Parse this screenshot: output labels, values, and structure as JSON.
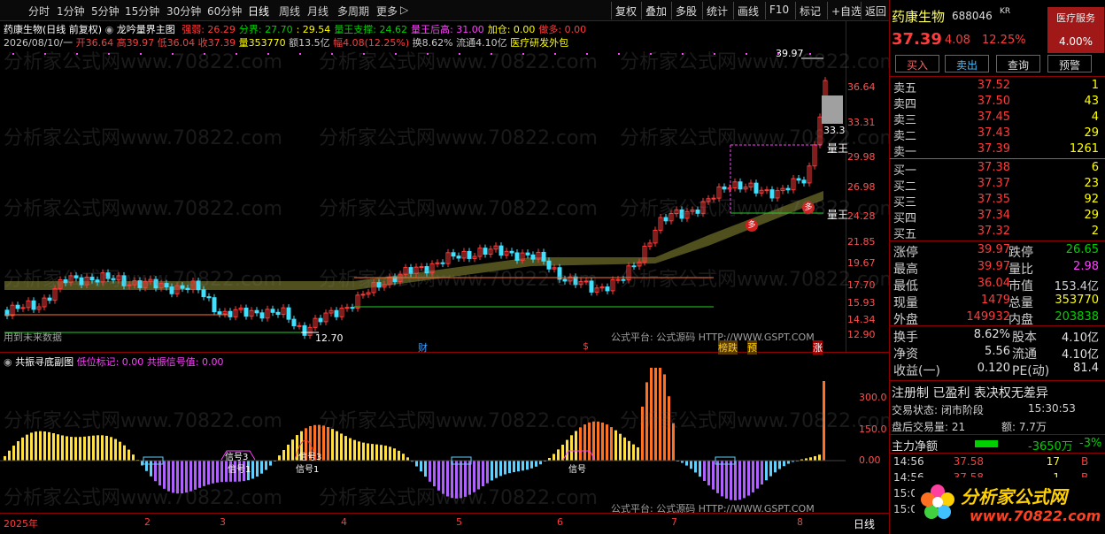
{
  "toolbar": {
    "periods": [
      "分时",
      "1分钟",
      "5分钟",
      "15分钟",
      "30分钟",
      "60分钟",
      "日线",
      "周线",
      "月线",
      "多周期",
      "更多"
    ],
    "more_arrow": "▷",
    "right_items": [
      "复权",
      "叠加",
      "多股",
      "统计",
      "画线",
      "F10",
      "标记",
      "+自选",
      "返回"
    ]
  },
  "main_chart": {
    "title": "药康生物(日线 前复权)",
    "indicator_name": "龙吟量界主图",
    "indicator_values": [
      {
        "label": "强弱: 26.29",
        "color": "#ff3b3b"
      },
      {
        "label": "分界: 27.70",
        "color": "#00d000"
      },
      {
        "label": ": 29.54",
        "color": "#ffff00"
      },
      {
        "label": "量王支撑: 24.62",
        "color": "#00d000"
      },
      {
        "label": "量王后高: 31.00",
        "color": "#ff40ff"
      },
      {
        "label": "加仓: 0.00",
        "color": "#ffff00"
      },
      {
        "label": "做多: 0.00",
        "color": "#ff3b3b"
      }
    ],
    "ohlc_line": [
      {
        "text": "2026/08/10/一 ",
        "color": "#c8c8c8"
      },
      {
        "text": "开36.64 ",
        "color": "#ff3b3b"
      },
      {
        "text": "高39.97 ",
        "color": "#ff3b3b"
      },
      {
        "text": "低36.04 ",
        "color": "#ff3b3b"
      },
      {
        "text": "收37.39 ",
        "color": "#ff3b3b"
      },
      {
        "text": "量353770 ",
        "color": "#ffff00"
      },
      {
        "text": "额13.5亿 ",
        "color": "#c8c8c8"
      },
      {
        "text": "幅4.08(12.25%) ",
        "color": "#ff3b3b"
      },
      {
        "text": "换8.62% ",
        "color": "#c8c8c8"
      },
      {
        "text": "流通4.10亿 ",
        "color": "#c8c8c8"
      },
      {
        "text": "医疗研发外包",
        "color": "#ffff00"
      }
    ],
    "price_axis": [
      "36.64",
      "33.31",
      "29.98",
      "26.98",
      "24.28",
      "21.85",
      "19.67",
      "17.70",
      "15.93",
      "14.34",
      "12.90"
    ],
    "high_marker": "39.97",
    "low_marker": "12.70",
    "cursor_price": "33.3",
    "label_liangwang": "量王",
    "note_future": "用到未来数据",
    "platform_note": "公式平台: 公式源码 HTTP://WWW.GSPT.COM",
    "event_badges": [
      {
        "text": "财",
        "color": "#3aa0ff"
      },
      {
        "text": "$",
        "color": "#ff3b3b"
      },
      {
        "text": "榜跌",
        "color": "#ffd000"
      },
      {
        "text": "预",
        "color": "#ffd000"
      },
      {
        "text": "涨",
        "color": "#ff3b3b"
      }
    ],
    "signal_badge": "多"
  },
  "sub_chart": {
    "name": "共振寻底副图",
    "values": [
      {
        "label": "低位标记: 0.00",
        "color": "#ff40ff"
      },
      {
        "label": "共振信号值: 0.00",
        "color": "#ff40ff"
      }
    ],
    "axis": [
      "300.0",
      "150.0",
      "0.00"
    ],
    "signal_labels": [
      "信号3",
      "信号1",
      "信号3",
      "信号1",
      "信号"
    ],
    "platform_note": "公式平台: 公式源码 HTTP://WWW.GSPT.COM"
  },
  "time_axis": {
    "labels": [
      "2025年",
      "2",
      "3",
      "4",
      "5",
      "6",
      "7",
      "8"
    ],
    "period": "日线"
  },
  "watermark": "分析家公式网www.70822.com",
  "stock": {
    "name": "药康生物",
    "code": "688046",
    "market": "KR",
    "sector": "医疗服务",
    "sector_change": "4.00%",
    "price": "37.39",
    "change": "4.08",
    "change_pct": "12.25%"
  },
  "trade_buttons": [
    "买入",
    "卖出",
    "查询",
    "预警"
  ],
  "order_book": {
    "asks": [
      {
        "label": "卖五",
        "price": "37.52",
        "vol": "1"
      },
      {
        "label": "卖四",
        "price": "37.50",
        "vol": "43"
      },
      {
        "label": "卖三",
        "price": "37.45",
        "vol": "4"
      },
      {
        "label": "卖二",
        "price": "37.43",
        "vol": "29"
      },
      {
        "label": "卖一",
        "price": "37.39",
        "vol": "1261"
      }
    ],
    "bids": [
      {
        "label": "买一",
        "price": "37.38",
        "vol": "6"
      },
      {
        "label": "买二",
        "price": "37.37",
        "vol": "23"
      },
      {
        "label": "买三",
        "price": "37.35",
        "vol": "92"
      },
      {
        "label": "买四",
        "price": "37.34",
        "vol": "29"
      },
      {
        "label": "买五",
        "price": "37.32",
        "vol": "2"
      }
    ]
  },
  "stats": [
    {
      "l1": "涨停",
      "v1": "39.97",
      "c1": "#ff3b3b",
      "l2": "跌停",
      "v2": "26.65",
      "c2": "#00d000"
    },
    {
      "l1": "最高",
      "v1": "39.97",
      "c1": "#ff3b3b",
      "l2": "量比",
      "v2": "2.98",
      "c2": "#ff40ff"
    },
    {
      "l1": "最低",
      "v1": "36.04",
      "c1": "#ff3b3b",
      "l2": "市值",
      "v2": "153.4亿",
      "c2": "#d0d0d0"
    },
    {
      "l1": "现量",
      "v1": "1479",
      "c1": "#ff3b3b",
      "l2": "总量",
      "v2": "353770",
      "c2": "#ffff00"
    },
    {
      "l1": "外盘",
      "v1": "149932",
      "c1": "#ff3b3b",
      "l2": "内盘",
      "v2": "203838",
      "c2": "#00d000"
    }
  ],
  "stats2": [
    {
      "l1": "换手",
      "v1": "8.62%",
      "l2": "股本",
      "v2": "4.10亿"
    },
    {
      "l1": "净资",
      "v1": "5.56",
      "l2": "流通",
      "v2": "4.10亿"
    },
    {
      "l1": "收益(一)",
      "v1": "0.120",
      "l2": "PE(动)",
      "v2": "81.4"
    }
  ],
  "registration": "注册制 已盈利 表决权无差异",
  "trade_state": {
    "label": "交易状态: 闭市阶段",
    "time": "15:30:53"
  },
  "after_hours": {
    "label": "盘后交易量: 21",
    "amount": "额: 7.7万"
  },
  "main_flow": {
    "label": "主力净额",
    "value": "-3650万",
    "pct": "-3%"
  },
  "ticks": [
    {
      "time": "14:56",
      "price": "37.58",
      "vol": "17",
      "side": "B"
    },
    {
      "time": "14:56",
      "price": "37.58",
      "vol": "1",
      "side": "B"
    },
    {
      "time": "15:00",
      "price": "",
      "vol": "",
      "side": ""
    },
    {
      "time": "15:00",
      "price": "",
      "vol": "",
      "side": ""
    }
  ],
  "logo": {
    "title": "分析家公式网",
    "url": "www.70822.com"
  }
}
